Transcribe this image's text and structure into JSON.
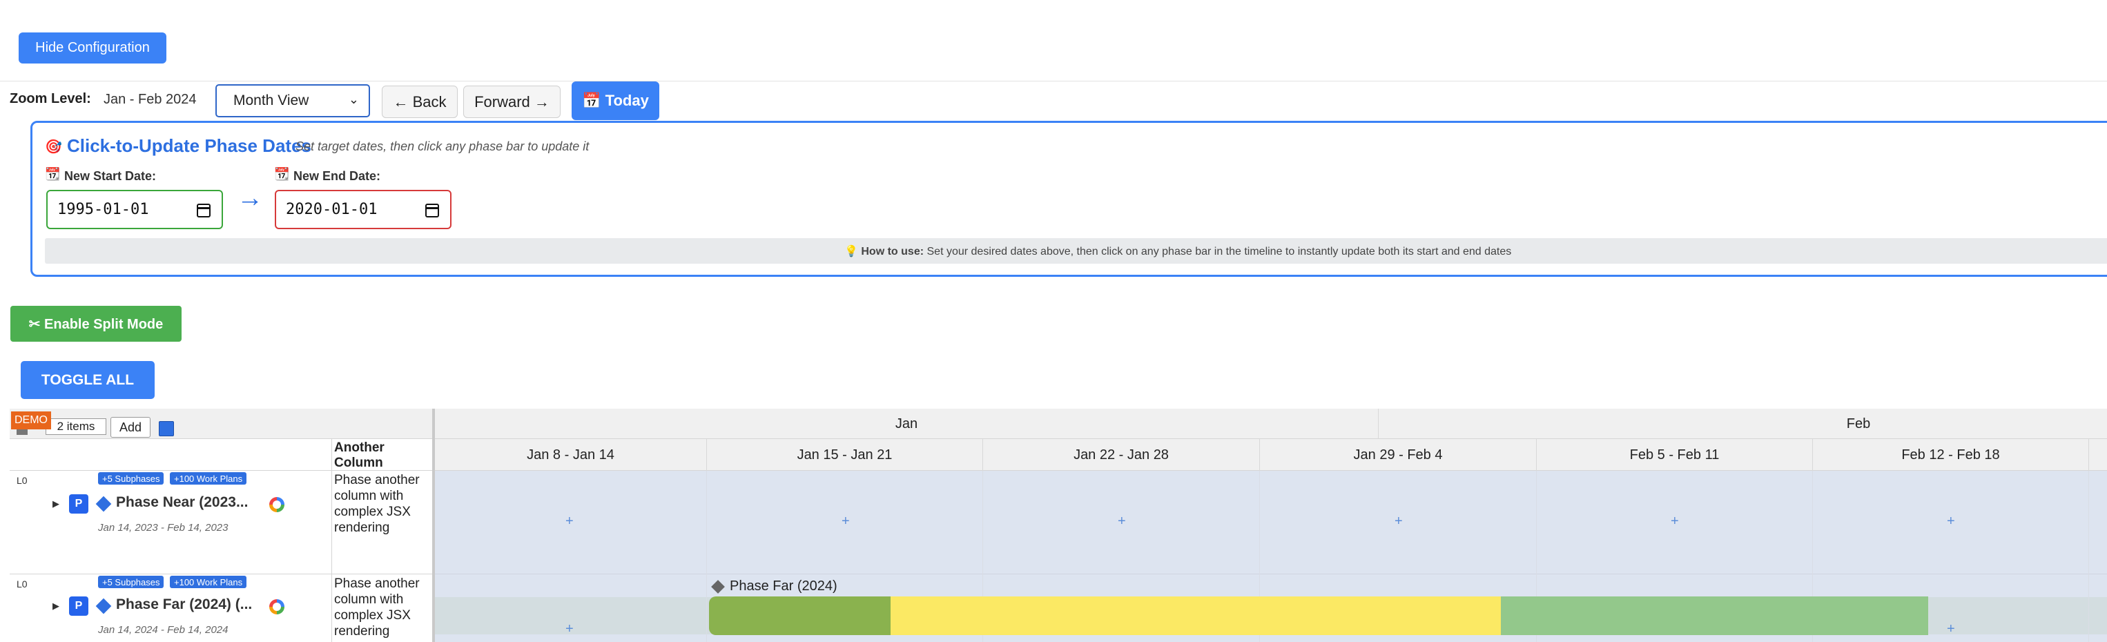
{
  "config": {
    "hide_label": "Hide Configuration"
  },
  "toolbar": {
    "zoom_label": "Zoom Level:",
    "zoom_range": "Jan - Feb 2024",
    "view_select": "Month View",
    "back_label": "← Back",
    "forward_label": "Forward →",
    "today_label": "📅 Today"
  },
  "click_update": {
    "title": "Click-to-Update Phase Dates",
    "subtitle": "Set target dates, then click any phase bar to update it",
    "start_label": "New Start Date:",
    "end_label": "New End Date:",
    "start_value": "1995-01-01",
    "end_value": "2020-01-01",
    "arrow": "→",
    "howto_bold": "How to use:",
    "howto_text": "Set your desired dates above, then click on any phase bar in the timeline to instantly update both its start and end dates"
  },
  "split_mode_label": "✂ Enable Split Mode",
  "toggle_all_label": "TOGGLE ALL",
  "grid": {
    "demo_badge": "DEMO",
    "items_label": "2 items",
    "add_label": "Add",
    "another_column_header": "Another Column",
    "rows": [
      {
        "level": "L0",
        "badge_sub": "+5 Subphases",
        "badge_plans": "+100 Work Plans",
        "p_label": "P",
        "name": "Phase Near (2023...",
        "dates": "Jan 14, 2023 - Feb 14, 2023",
        "another": "Phase another column with complex JSX rendering"
      },
      {
        "level": "L0",
        "badge_sub": "+5 Subphases",
        "badge_plans": "+100 Work Plans",
        "p_label": "P",
        "name": "Phase Far (2024) (...",
        "dates": "Jan 14, 2024 - Feb 14, 2024",
        "another": "Phase another column with complex JSX rendering"
      }
    ]
  },
  "timeline": {
    "months": [
      "Jan",
      "Feb"
    ],
    "weeks": [
      "Jan 8 - Jan 14",
      "Jan 15 - Jan 21",
      "Jan 22 - Jan 28",
      "Jan 29 - Feb 4",
      "Feb 5 - Feb 11",
      "Feb 12 - Feb 18"
    ],
    "bar_label": "Phase Far (2024)",
    "plus": "+"
  },
  "colors": {
    "accent": "#3b82f6",
    "split_green": "#4caf50",
    "demo_orange": "#e8661c",
    "bar_green": "#8ab24e",
    "bar_yellow": "#fbe964",
    "bar_lightgreen": "#93c88b",
    "row_bg": "#dde4f0"
  }
}
